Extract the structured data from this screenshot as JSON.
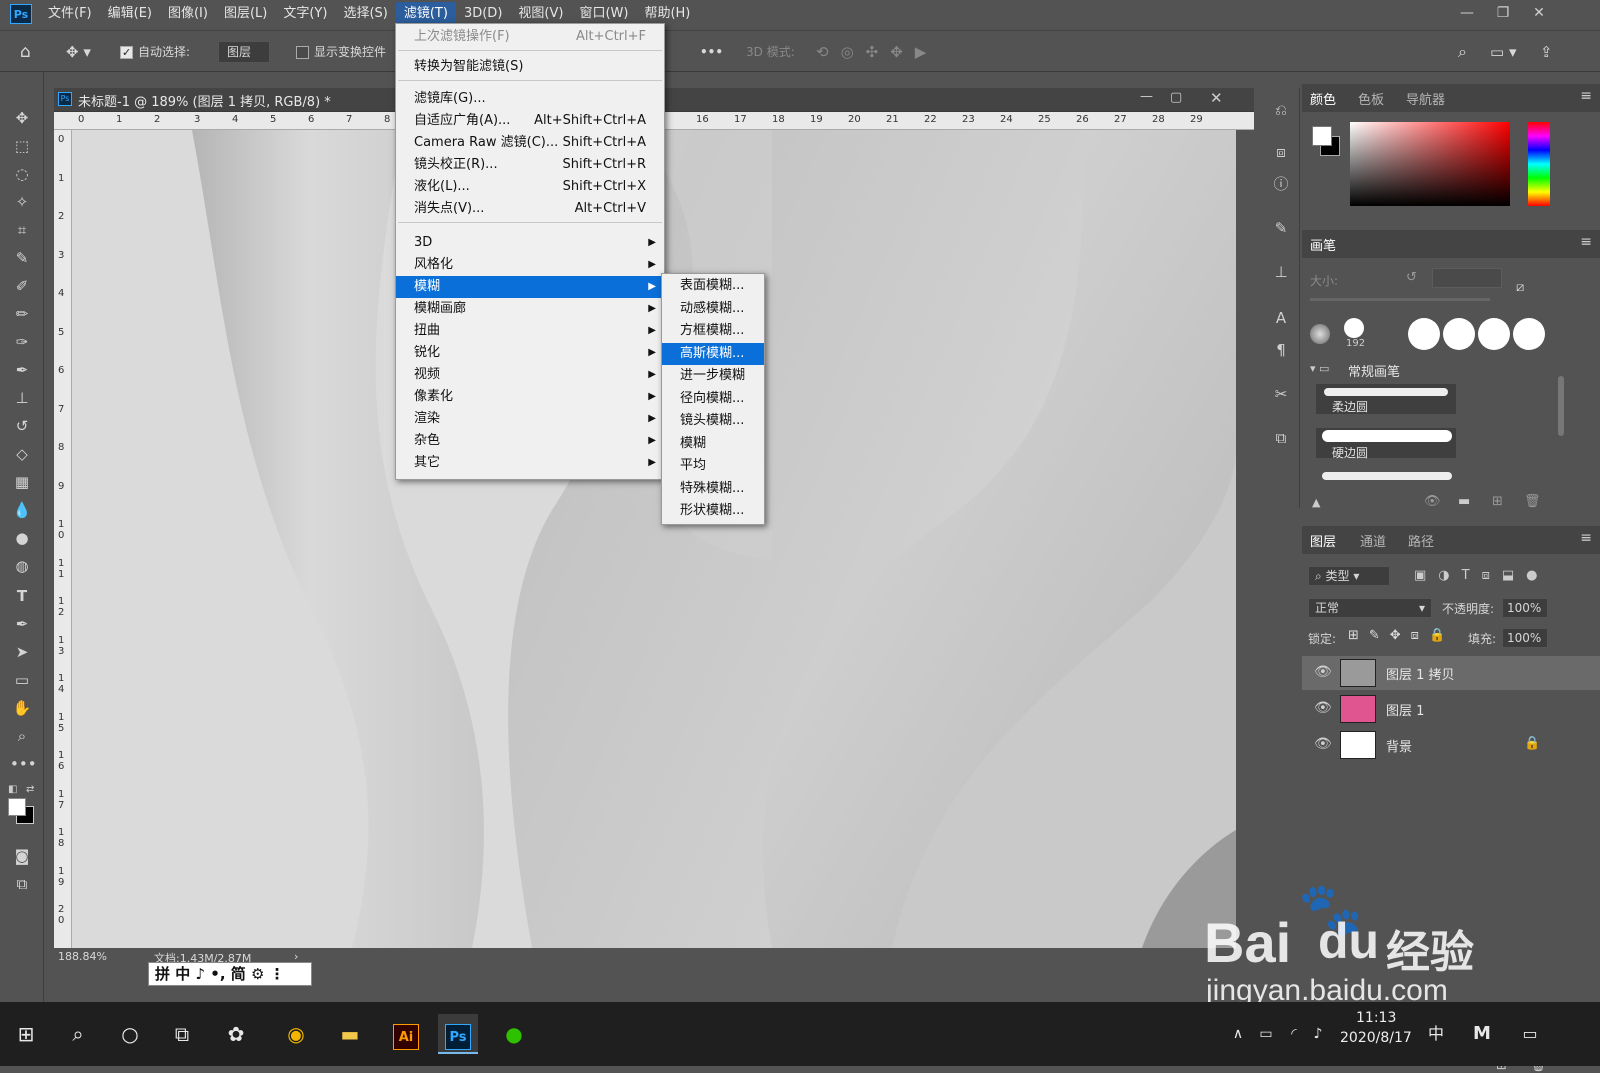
{
  "app": {
    "logo": "Ps"
  },
  "menubar": {
    "items": [
      "文件(F)",
      "编辑(E)",
      "图像(I)",
      "图层(L)",
      "文字(Y)",
      "选择(S)",
      "滤镜(T)",
      "3D(D)",
      "视图(V)",
      "窗口(W)",
      "帮助(H)"
    ],
    "active": "滤镜(T)"
  },
  "options_bar": {
    "auto_select_label": "自动选择:",
    "auto_select_checked": true,
    "target_value": "图层",
    "show_transform_label": "显示变换控件",
    "more": "•••",
    "mode_3d_label": "3D 模式:"
  },
  "document": {
    "tab_title": "未标题-1 @ 189% (图层 1 拷贝, RGB/8) *",
    "ruler_top": [
      "0",
      "1",
      "2",
      "3",
      "4",
      "5",
      "6",
      "7",
      "8",
      "16",
      "17",
      "18",
      "19",
      "20",
      "21",
      "22",
      "23",
      "24",
      "25",
      "26",
      "27",
      "28",
      "29"
    ],
    "ruler_left": [
      "0",
      "1",
      "2",
      "3",
      "4",
      "5",
      "6",
      "7",
      "8",
      "9",
      "1\n0",
      "1\n1",
      "1\n2",
      "1\n3",
      "1\n4",
      "1\n5",
      "1\n6",
      "1\n7",
      "1\n8",
      "1\n9",
      "2\n0"
    ],
    "zoom": "188.84%",
    "doc_info": "文档:1.43M/2.87M"
  },
  "filter_menu": {
    "items": [
      {
        "label": "上次滤镜操作(F)",
        "shortcut": "Alt+Ctrl+F",
        "disabled": true
      },
      {
        "label": "转换为智能滤镜(S)",
        "shortcut": ""
      },
      {
        "label": "滤镜库(G)...",
        "shortcut": ""
      },
      {
        "label": "自适应广角(A)...",
        "shortcut": "Alt+Shift+Ctrl+A"
      },
      {
        "label": "Camera Raw 滤镜(C)...",
        "shortcut": "Shift+Ctrl+A"
      },
      {
        "label": "镜头校正(R)...",
        "shortcut": "Shift+Ctrl+R"
      },
      {
        "label": "液化(L)...",
        "shortcut": "Shift+Ctrl+X"
      },
      {
        "label": "消失点(V)...",
        "shortcut": "Alt+Ctrl+V"
      },
      {
        "label": "3D",
        "submenu": true
      },
      {
        "label": "风格化",
        "submenu": true
      },
      {
        "label": "模糊",
        "submenu": true,
        "highlighted": true
      },
      {
        "label": "模糊画廊",
        "submenu": true
      },
      {
        "label": "扭曲",
        "submenu": true
      },
      {
        "label": "锐化",
        "submenu": true
      },
      {
        "label": "视频",
        "submenu": true
      },
      {
        "label": "像素化",
        "submenu": true
      },
      {
        "label": "渲染",
        "submenu": true
      },
      {
        "label": "杂色",
        "submenu": true
      },
      {
        "label": "其它",
        "submenu": true
      }
    ]
  },
  "blur_submenu": {
    "items": [
      "表面模糊...",
      "动感模糊...",
      "方框模糊...",
      "高斯模糊...",
      "进一步模糊",
      "径向模糊...",
      "镜头模糊...",
      "模糊",
      "平均",
      "特殊模糊...",
      "形状模糊..."
    ],
    "highlighted": "高斯模糊..."
  },
  "color_panel": {
    "tabs": [
      "颜色",
      "色板",
      "导航器"
    ],
    "active": "颜色",
    "hue": "#ff0000"
  },
  "brush_panel": {
    "title": "画笔",
    "size_label": "大小:",
    "brush_size_value": "192",
    "group_name": "常规画笔",
    "brushes": [
      "柔边圆",
      "硬边圆"
    ]
  },
  "layers_panel": {
    "tabs": [
      "图层",
      "通道",
      "路径"
    ],
    "active": "图层",
    "filter_label": "类型",
    "blend_mode": "正常",
    "opacity_label": "不透明度:",
    "opacity": "100%",
    "lock_label": "锁定:",
    "fill_label": "填充:",
    "fill": "100%",
    "layers": [
      {
        "name": "图层 1 拷贝",
        "thumb": "#9a9a9a",
        "selected": true
      },
      {
        "name": "图层 1",
        "thumb": "#e05590",
        "selected": false
      },
      {
        "name": "背景",
        "thumb": "#ffffff",
        "selected": false,
        "locked": true
      }
    ]
  },
  "ime": {
    "text": "拼 中 ♪ •, 简 ⚙ ⋮"
  },
  "taskbar": {
    "time": "11:13",
    "date": "2020/8/17"
  },
  "watermark": {
    "brand": "Bai",
    "brand2": "du",
    "brand3": "经验",
    "url": "jingyan.baidu.com"
  }
}
